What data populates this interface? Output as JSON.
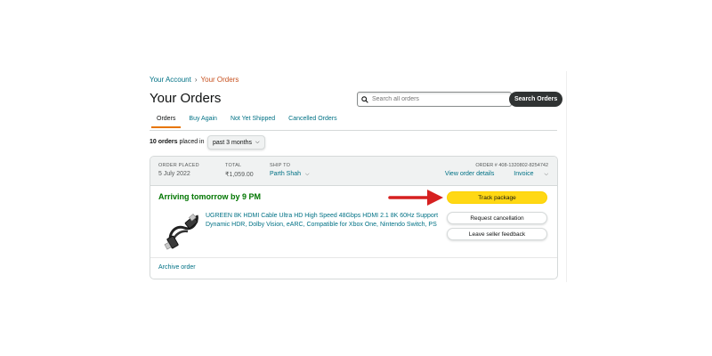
{
  "breadcrumb": {
    "account": "Your Account",
    "separator": "›",
    "current": "Your Orders"
  },
  "page_title": "Your Orders",
  "search": {
    "placeholder": "Search all orders",
    "button_label": "Search Orders"
  },
  "tabs": [
    {
      "label": "Orders",
      "active": true
    },
    {
      "label": "Buy Again",
      "active": false
    },
    {
      "label": "Not Yet Shipped",
      "active": false
    },
    {
      "label": "Cancelled Orders",
      "active": false
    }
  ],
  "orders_summary": {
    "count_text": "10 orders",
    "placed_in_text": "placed in",
    "period_selected": "past 3 months"
  },
  "order": {
    "placed_label": "ORDER PLACED",
    "placed_value": "5 July 2022",
    "total_label": "TOTAL",
    "total_value": "₹1,059.00",
    "ship_to_label": "SHIP TO",
    "ship_to_value": "Parth Shah",
    "order_number_label": "ORDER # 408-1320802-8254742",
    "view_details_label": "View order details",
    "invoice_label": "Invoice",
    "status": "Arriving tomorrow by 9 PM",
    "item_title": "UGREEN 8K HDMI Cable Ultra HD High Speed 48Gbps HDMI 2.1 8K 60Hz Support Dynamic HDR, Dolby Vision, eARC, Compatible for Xbox One, Nintendo Switch, PS",
    "buttons": {
      "track": "Track package",
      "cancel": "Request cancellation",
      "feedback": "Leave seller feedback"
    },
    "archive_label": "Archive order"
  },
  "colors": {
    "link": "#007185",
    "status_green": "#007600",
    "primary_button": "#ffd814",
    "search_button": "#303333",
    "active_tab_underline": "#e77600",
    "annotation_arrow": "#d62020"
  },
  "icons": {
    "search": "search-icon",
    "chevron": "chevron-down-icon",
    "product": "hdmi-cable-image",
    "annotation": "red-arrow-annotation"
  }
}
